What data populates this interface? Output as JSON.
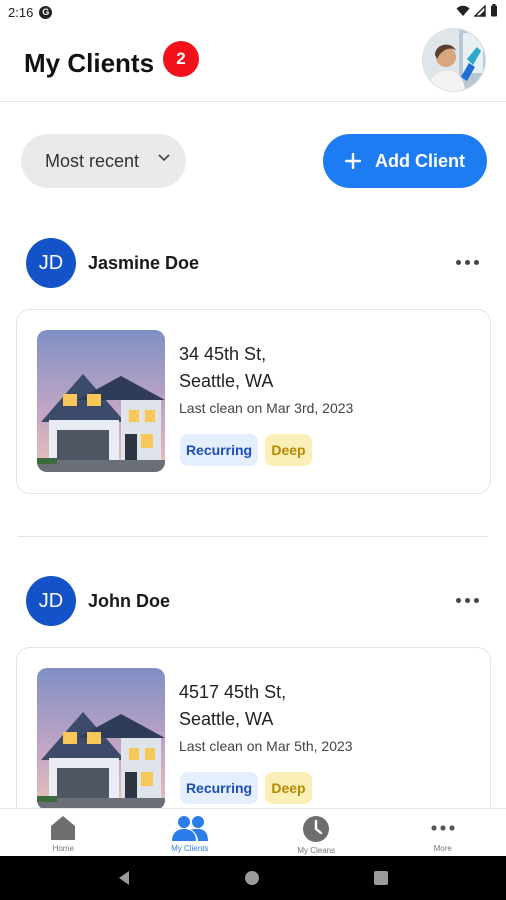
{
  "status_bar": {
    "time": "2:16",
    "app_glyph": "G"
  },
  "header": {
    "title": "My Clients",
    "badge_count": "2"
  },
  "controls": {
    "sort_label": "Most recent",
    "add_client_label": "Add Client"
  },
  "clients": [
    {
      "initials": "JD",
      "name": "Jasmine Doe",
      "address_line1": "34 45th St,",
      "address_line2": "Seattle, WA",
      "last_clean": "Last clean on Mar 3rd, 2023",
      "tags": [
        "Recurring",
        "Deep"
      ]
    },
    {
      "initials": "JD",
      "name": "John Doe",
      "address_line1": "4517 45th St,",
      "address_line2": "Seattle, WA",
      "last_clean": "Last clean on Mar 5th, 2023",
      "tags": [
        "Recurring",
        "Deep"
      ]
    }
  ],
  "bottom_nav": [
    {
      "label": "Home",
      "icon": "home-icon"
    },
    {
      "label": "My Clients",
      "icon": "people-icon",
      "active": true
    },
    {
      "label": "My Cleans",
      "icon": "clock-icon"
    },
    {
      "label": "More",
      "icon": "more-horizontal-icon"
    }
  ],
  "colors": {
    "accent": "#1d7cf1",
    "badge": "#f2101a",
    "initials_bg": "#1452c8",
    "recurring_bg": "#e4eefc",
    "deep_bg": "#fbefb8"
  }
}
